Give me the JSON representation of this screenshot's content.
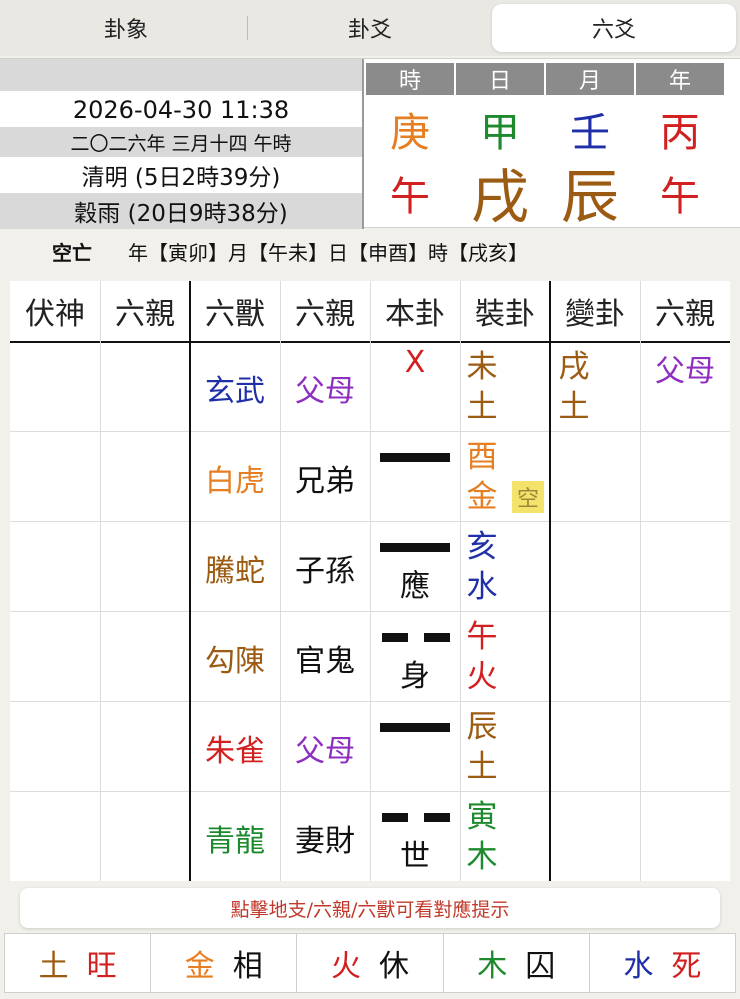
{
  "tabs": [
    {
      "label": "卦象",
      "active": false
    },
    {
      "label": "卦爻",
      "active": false
    },
    {
      "label": "六爻",
      "active": true
    }
  ],
  "info": {
    "datetime": "2026-04-30 11:38",
    "lunar": "二〇二六年 三月十四 午時",
    "term1": "清明 (5日2時39分)",
    "term2": "穀雨 (20日9時38分)"
  },
  "pillars": {
    "headers": [
      "時",
      "日",
      "月",
      "年"
    ],
    "stems": [
      {
        "char": "庚",
        "color": "#e67e22"
      },
      {
        "char": "甲",
        "color": "#1e8a2e"
      },
      {
        "char": "壬",
        "color": "#1f2fa8"
      },
      {
        "char": "丙",
        "color": "#d21f1f"
      }
    ],
    "branches": [
      {
        "char": "午",
        "color": "#d21f1f"
      },
      {
        "char": "戌",
        "color": "#9c5b12"
      },
      {
        "char": "辰",
        "color": "#9c5b12"
      },
      {
        "char": "午",
        "color": "#d21f1f"
      }
    ]
  },
  "void": {
    "label": "空亡",
    "text": "年【寅卯】月【午未】日【申酉】時【戌亥】"
  },
  "grid": {
    "headers": [
      "伏神",
      "六親",
      "六獸",
      "六親",
      "本卦",
      "裝卦",
      "變卦",
      "六親"
    ],
    "rows": [
      {
        "beast": "玄武",
        "beast_color": "#1f2fa8",
        "relative": "父母",
        "relative_color": "#8e2fc0",
        "line": "x",
        "line_mark": "X",
        "mark_color": "#d21f1f",
        "zhi": "未",
        "element": "土",
        "zhi_color": "#9c5b12",
        "changed_zhi": "戌",
        "changed_element": "土",
        "changed_color": "#9c5b12",
        "changed_relative": "父母",
        "changed_relative_color": "#8e2fc0"
      },
      {
        "beast": "白虎",
        "beast_color": "#e67e22",
        "relative": "兄弟",
        "relative_color": "#111111",
        "line": "yang",
        "line_mark": "",
        "zhi": "酉",
        "element": "金",
        "zhi_color": "#e67e22",
        "empty_badge": "空"
      },
      {
        "beast": "騰蛇",
        "beast_color": "#9c5b12",
        "relative": "子孫",
        "relative_color": "#111111",
        "line": "yang",
        "line_mark": "應",
        "zhi": "亥",
        "element": "水",
        "zhi_color": "#1f2fa8"
      },
      {
        "beast": "勾陳",
        "beast_color": "#9c5b12",
        "relative": "官鬼",
        "relative_color": "#111111",
        "line": "yin",
        "line_mark": "身",
        "zhi": "午",
        "element": "火",
        "zhi_color": "#d21f1f"
      },
      {
        "beast": "朱雀",
        "beast_color": "#d21f1f",
        "relative": "父母",
        "relative_color": "#8e2fc0",
        "line": "yang",
        "line_mark": "",
        "zhi": "辰",
        "element": "土",
        "zhi_color": "#9c5b12"
      },
      {
        "beast": "青龍",
        "beast_color": "#1e8a2e",
        "relative": "妻財",
        "relative_color": "#111111",
        "line": "yin",
        "line_mark": "世",
        "zhi": "寅",
        "element": "木",
        "zhi_color": "#1e8a2e"
      }
    ]
  },
  "hint": "點擊地支/六親/六獸可看對應提示",
  "strength": [
    {
      "element": "土",
      "color": "#9c5b12",
      "state": "旺",
      "state_color": "#d21f1f"
    },
    {
      "element": "金",
      "color": "#e67e22",
      "state": "相",
      "state_color": "#111111"
    },
    {
      "element": "火",
      "color": "#d21f1f",
      "state": "休",
      "state_color": "#111111"
    },
    {
      "element": "木",
      "color": "#1e8a2e",
      "state": "囚",
      "state_color": "#111111"
    },
    {
      "element": "水",
      "color": "#1f2fa8",
      "state": "死",
      "state_color": "#d21f1f"
    }
  ]
}
